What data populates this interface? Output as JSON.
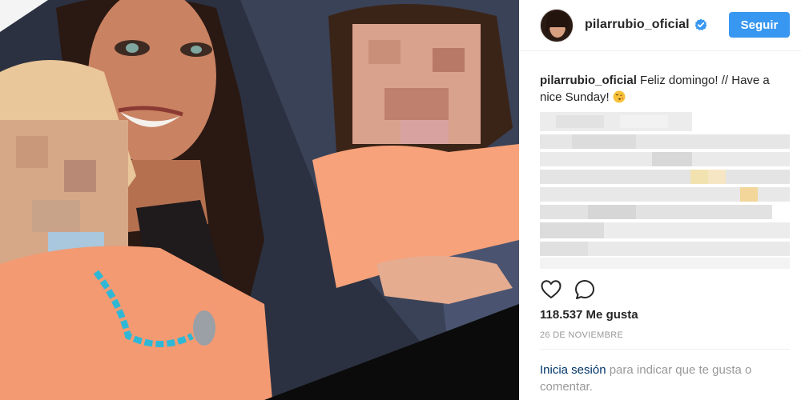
{
  "post": {
    "photo_alt": "",
    "header": {
      "username": "pilarrubio_oficial",
      "verified": true,
      "follow_label": "Seguir"
    },
    "caption": {
      "username": "pilarrubio_oficial",
      "text": " Feliz domingo! // Have a nice Sunday!",
      "emoji": "kissing-face-emoji"
    },
    "actions": {
      "like_icon": "heart-icon",
      "comment_icon": "comment-icon"
    },
    "likes": "118.537 Me gusta",
    "date": "26 DE NOVIEMBRE",
    "login": {
      "link_text": "Inicia sesión",
      "rest_text": " para indicar que te gusta o comentar."
    }
  },
  "colors": {
    "follow_button": "#3897f0",
    "link": "#003569",
    "muted": "#999999",
    "text": "#262626"
  }
}
